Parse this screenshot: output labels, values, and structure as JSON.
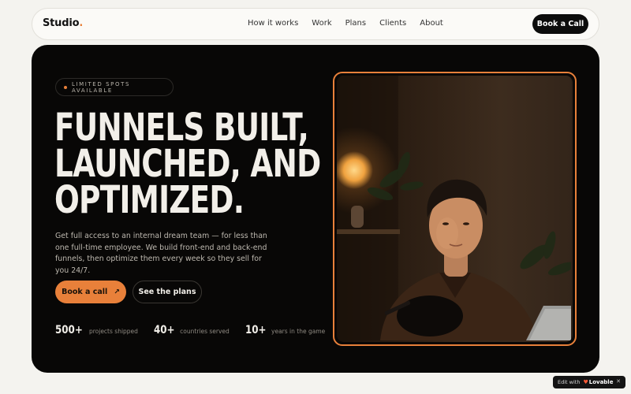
{
  "nav": {
    "logo_text": "Studio",
    "logo_dot": ".",
    "links": [
      "How it works",
      "Work",
      "Plans",
      "Clients",
      "About"
    ],
    "cta_label": "Book a Call"
  },
  "hero": {
    "badge": "LIMITED SPOTS AVAILABLE",
    "headline": [
      "FUNNELS BUILT,",
      "LAUNCHED, AND",
      "OPTIMIZED."
    ],
    "description": "Get full access to an internal dream team — for less than one full-time employee. We build front-end and back-end funnels, then optimize them every week so they sell for you 24/7.",
    "primary_button": "Book a call",
    "primary_button_icon": "arrow-up-right-icon",
    "secondary_button": "See the plans",
    "stats": [
      {
        "value": "500+",
        "label": "projects shipped"
      },
      {
        "value": "40+",
        "label": "countries served"
      },
      {
        "value": "10+",
        "label": "years in the game"
      }
    ],
    "photo_alt": "portrait-photo"
  },
  "lovable_badge": {
    "edit_label": "Edit with",
    "brand": "Lovable",
    "close_icon": "close-icon"
  },
  "colors": {
    "accent": "#e8803a",
    "hero_bg": "#080706",
    "page_bg": "#f4f3ef"
  }
}
